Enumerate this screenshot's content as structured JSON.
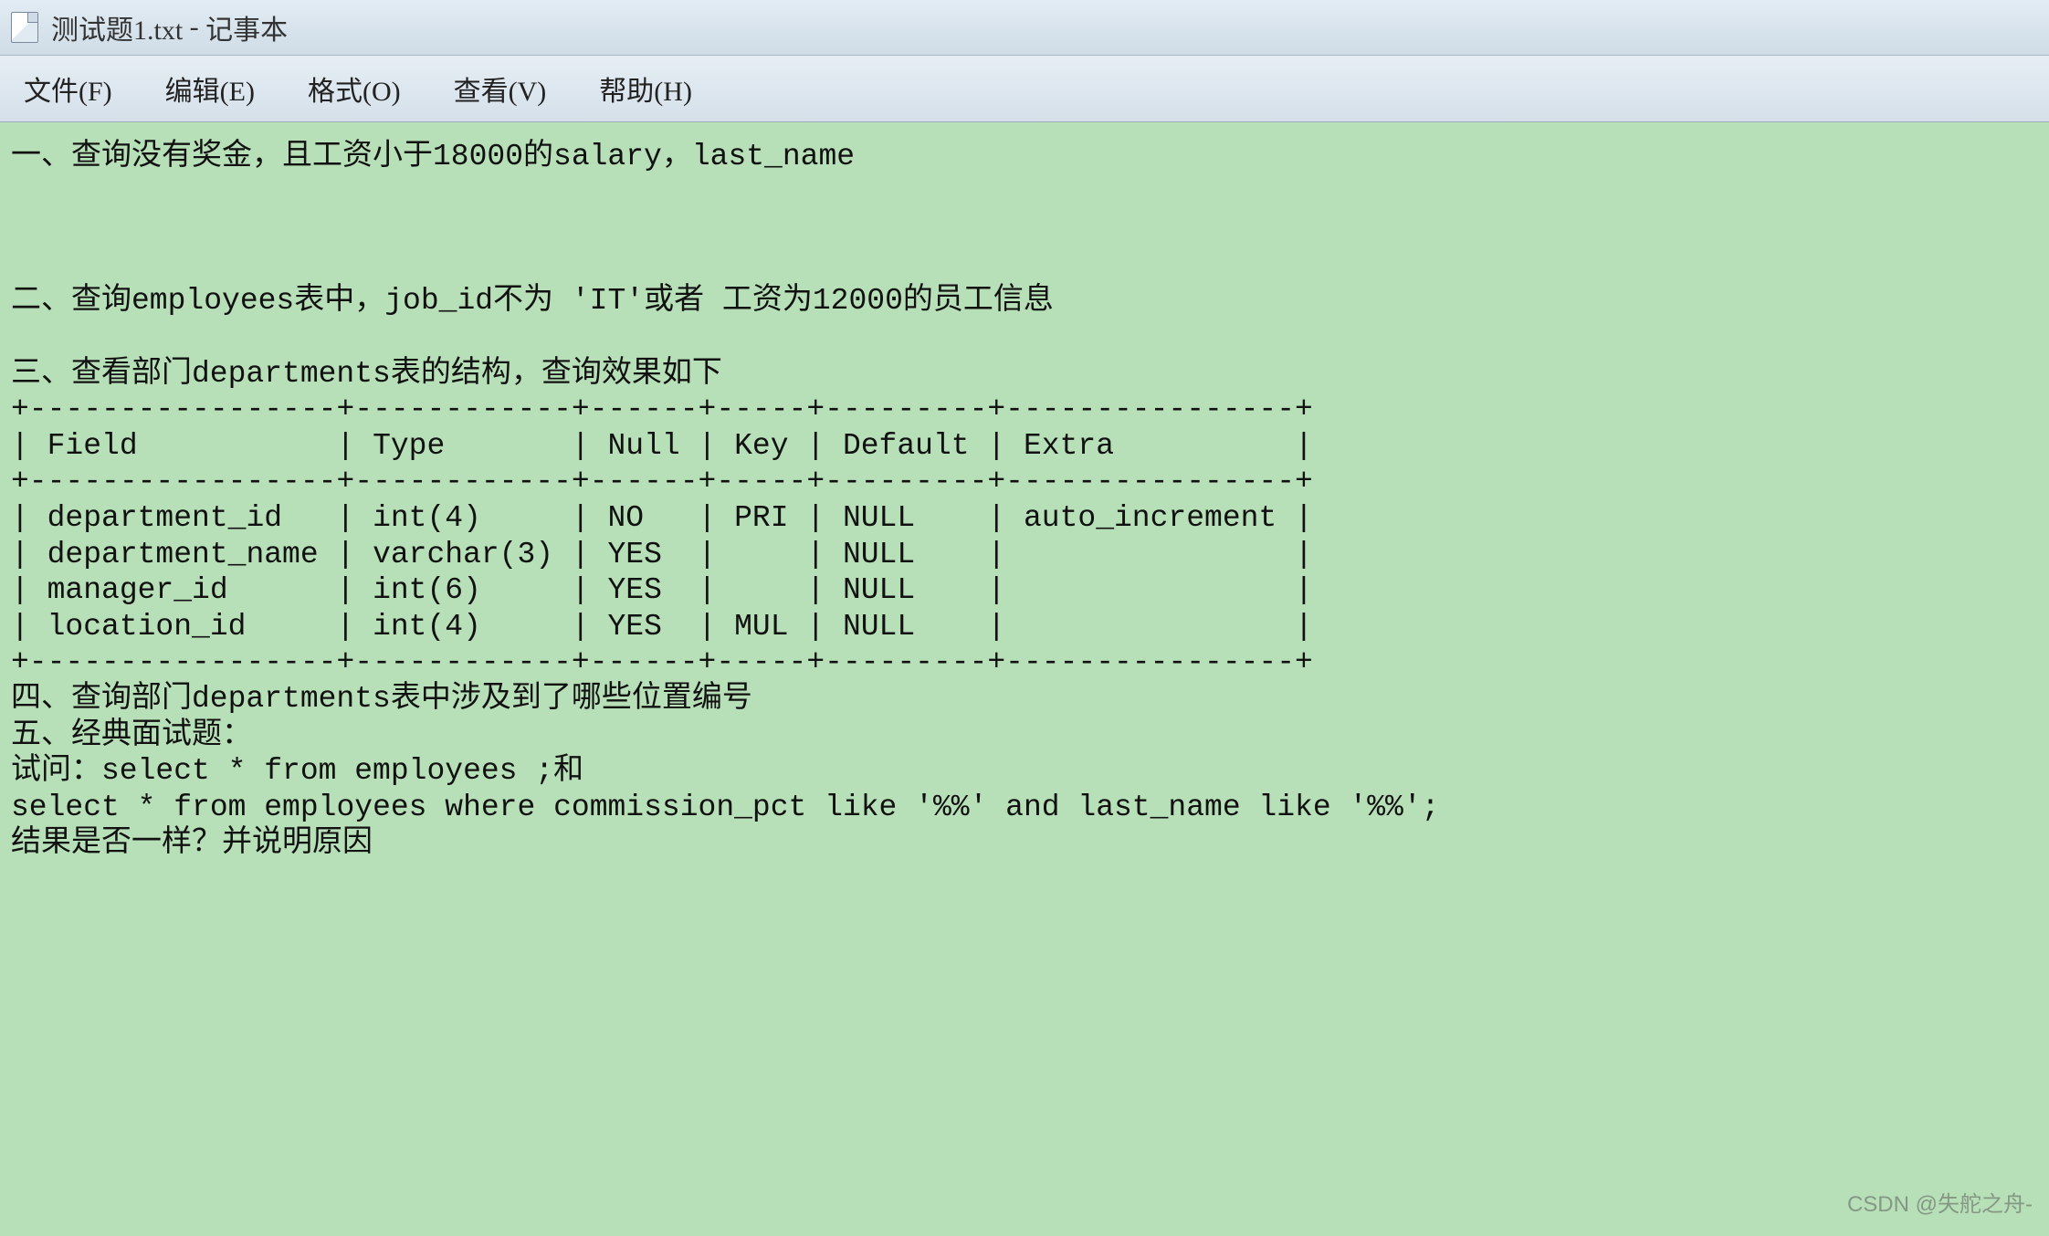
{
  "titlebar": {
    "filename": "测试题1.txt",
    "appname": "记事本"
  },
  "menubar": {
    "file": "文件(F)",
    "edit": "编辑(E)",
    "format": "格式(O)",
    "view": "查看(V)",
    "help": "帮助(H)"
  },
  "content": {
    "line1": "一、查询没有奖金，且工资小于18000的salary，last_name",
    "line2": "",
    "line3": "",
    "line4": "二、查询employees表中，job_id不为 'IT'或者 工资为12000的员工信息",
    "line5": "",
    "line6": "三、查看部门departments表的结构，查询效果如下",
    "table_border_top": "+-----------------+------------+------+-----+---------+----------------+",
    "table_header": "| Field           | Type       | Null | Key | Default | Extra          |",
    "table_border_mid": "+-----------------+------------+------+-----+---------+----------------+",
    "table_row1": "| department_id   | int(4)     | NO   | PRI | NULL    | auto_increment |",
    "table_row2": "| department_name | varchar(3) | YES  |     | NULL    |                |",
    "table_row3": "| manager_id      | int(6)     | YES  |     | NULL    |                |",
    "table_row4": "| location_id     | int(4)     | YES  | MUL | NULL    |                |",
    "table_border_bot": "+-----------------+------------+------+-----+---------+----------------+",
    "line7": "四、查询部门departments表中涉及到了哪些位置编号",
    "line8": "五、经典面试题：",
    "line9": "试问：select * from employees ;和",
    "line10": "select * from employees where commission_pct like '%%' and last_name like '%%';",
    "line11": "结果是否一样？并说明原因"
  },
  "table_data": {
    "columns": [
      "Field",
      "Type",
      "Null",
      "Key",
      "Default",
      "Extra"
    ],
    "rows": [
      {
        "Field": "department_id",
        "Type": "int(4)",
        "Null": "NO",
        "Key": "PRI",
        "Default": "NULL",
        "Extra": "auto_increment"
      },
      {
        "Field": "department_name",
        "Type": "varchar(3)",
        "Null": "YES",
        "Key": "",
        "Default": "NULL",
        "Extra": ""
      },
      {
        "Field": "manager_id",
        "Type": "int(6)",
        "Null": "YES",
        "Key": "",
        "Default": "NULL",
        "Extra": ""
      },
      {
        "Field": "location_id",
        "Type": "int(4)",
        "Null": "YES",
        "Key": "MUL",
        "Default": "NULL",
        "Extra": ""
      }
    ]
  },
  "watermark": "CSDN @失舵之舟-"
}
